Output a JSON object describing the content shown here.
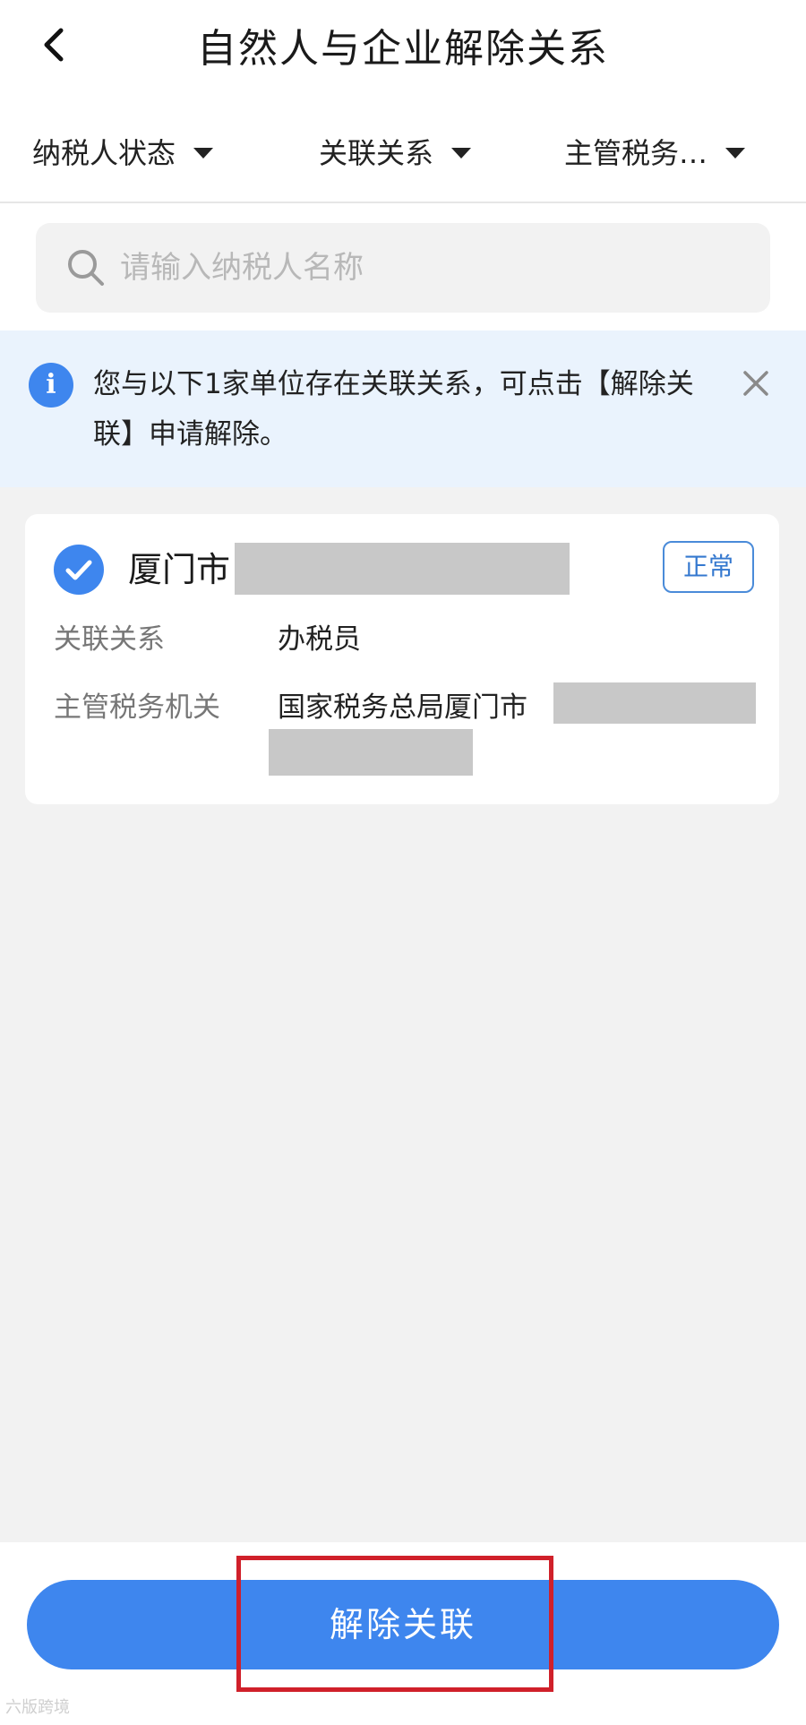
{
  "header": {
    "title": "自然人与企业解除关系",
    "back_icon": "chevron-left-icon"
  },
  "filters": [
    {
      "label": "纳税人状态",
      "icon": "caret-down-icon"
    },
    {
      "label": "关联关系",
      "icon": "caret-down-icon"
    },
    {
      "label": "主管税务…",
      "icon": "caret-down-icon"
    }
  ],
  "search": {
    "placeholder": "请输入纳税人名称",
    "value": "",
    "icon": "search-icon"
  },
  "notice": {
    "icon": "info-icon",
    "icon_glyph": "i",
    "text": "您与以下1家单位存在关联关系，可点击【解除关联】申请解除。",
    "close_icon": "close-icon"
  },
  "card": {
    "selected": true,
    "company_name": "厦门市",
    "status": "正常",
    "rows": [
      {
        "label": "关联关系",
        "value": "办税员"
      },
      {
        "label": "主管税务机关",
        "value": "国家税务总局厦门市"
      }
    ]
  },
  "action": {
    "button_label": "解除关联"
  },
  "watermark": "六版跨境",
  "colors": {
    "primary": "#3e86ee",
    "notice_bg": "#eaf3fd",
    "highlight": "#d0202a",
    "badge": "#3478cf"
  }
}
